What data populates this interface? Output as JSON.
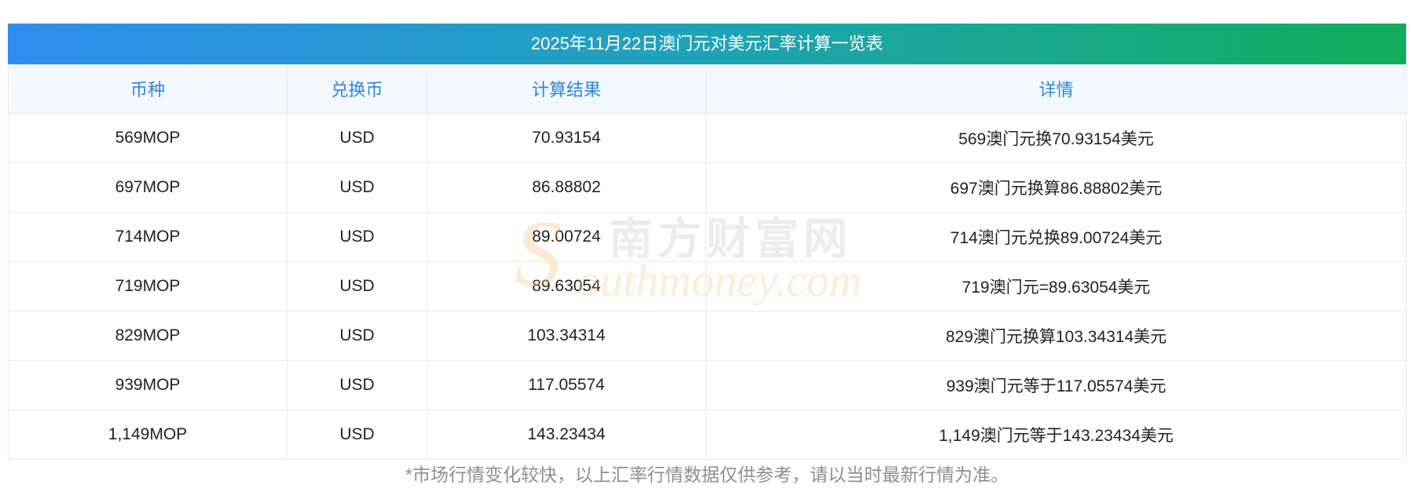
{
  "table": {
    "title": "2025年11月22日澳门元对美元汇率计算一览表",
    "headers": [
      "币种",
      "兑换币",
      "计算结果",
      "详情"
    ],
    "rows": [
      [
        "569MOP",
        "USD",
        "70.93154",
        "569澳门元换70.93154美元"
      ],
      [
        "697MOP",
        "USD",
        "86.88802",
        "697澳门元换算86.88802美元"
      ],
      [
        "714MOP",
        "USD",
        "89.00724",
        "714澳门元兑换89.00724美元"
      ],
      [
        "719MOP",
        "USD",
        "89.63054",
        "719澳门元=89.63054美元"
      ],
      [
        "829MOP",
        "USD",
        "103.34314",
        "829澳门元换算103.34314美元"
      ],
      [
        "939MOP",
        "USD",
        "117.05574",
        "939澳门元等于117.05574美元"
      ],
      [
        "1,149MOP",
        "USD",
        "143.23434",
        "1,149澳门元等于143.23434美元"
      ]
    ]
  },
  "note": "*市场行情变化较快，以上汇率行情数据仅供参考，请以当时最新行情为准。",
  "watermark": {
    "letter": "S",
    "cn": "南方财富网",
    "en": "outhmoney.com"
  },
  "colors": {
    "title_gradient_start": "#2f8ef0",
    "title_gradient_end": "#12ad5a",
    "header_text": "#2f86d6",
    "header_bg": "#f3f8fe"
  }
}
